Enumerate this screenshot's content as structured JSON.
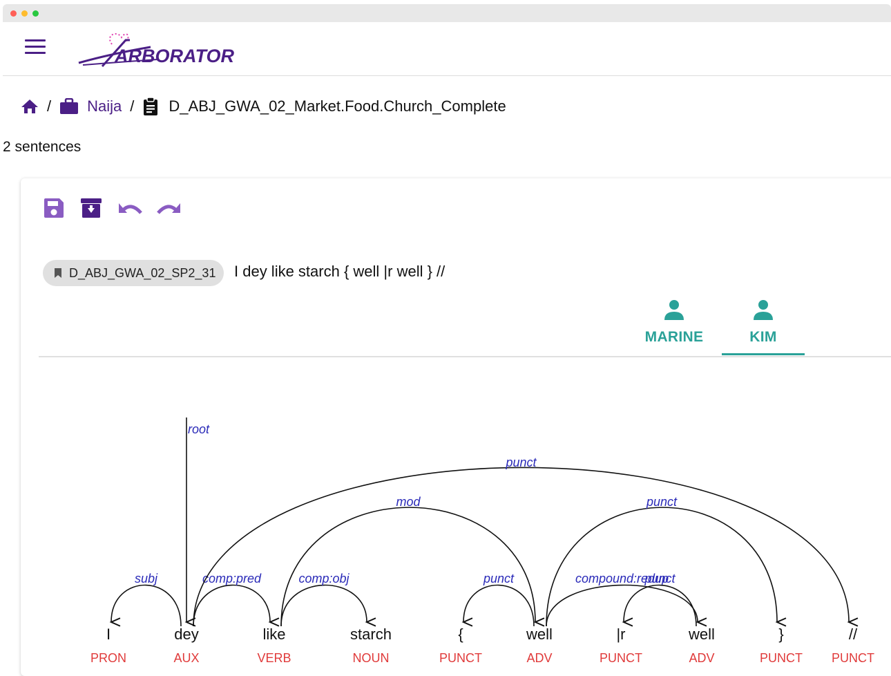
{
  "window": {
    "controls": [
      "close",
      "minimize",
      "maximize"
    ],
    "colors": {
      "close": "#ff5f57",
      "minimize": "#febc2e",
      "maximize": "#28c840"
    }
  },
  "app": {
    "logo_text": "ARBORATOR",
    "menu_icon": "hamburger-menu-icon"
  },
  "breadcrumb": {
    "home_icon": "home-icon",
    "project_icon": "briefcase-icon",
    "project": "Naija",
    "sample_icon": "clipboard-icon",
    "sample": "D_ABJ_GWA_02_Market.Food.Church_Complete",
    "separator": "/"
  },
  "sentence_count": "2 sentences",
  "toolbar": {
    "icons": [
      "save-icon",
      "archive-icon",
      "undo-icon",
      "redo-icon"
    ]
  },
  "sentence": {
    "id_icon": "bookmark-icon",
    "id": "D_ABJ_GWA_02_SP2_31",
    "text": "I dey like starch { well |r well } //"
  },
  "tabs": [
    {
      "label": "MARINE",
      "icon": "person-icon",
      "selected": false
    },
    {
      "label": "KIM",
      "icon": "person-icon",
      "selected": true
    }
  ],
  "colors": {
    "accent": "#4b1f86",
    "tab": "#2aa198",
    "relation": "#2a2ab8",
    "pos": "#e03a3a"
  },
  "tree": {
    "tokens": [
      {
        "form": "I",
        "upos": "PRON"
      },
      {
        "form": "dey",
        "upos": "AUX"
      },
      {
        "form": "like",
        "upos": "VERB"
      },
      {
        "form": "starch",
        "upos": "NOUN"
      },
      {
        "form": "{",
        "upos": "PUNCT"
      },
      {
        "form": "well",
        "upos": "ADV"
      },
      {
        "form": "|r",
        "upos": "PUNCT"
      },
      {
        "form": "well",
        "upos": "ADV"
      },
      {
        "form": "}",
        "upos": "PUNCT"
      },
      {
        "form": "//",
        "upos": "PUNCT"
      }
    ],
    "root": {
      "dep": 1,
      "label": "root"
    },
    "relations": [
      {
        "head": 1,
        "dep": 0,
        "label": "subj"
      },
      {
        "head": 1,
        "dep": 2,
        "label": "comp:pred"
      },
      {
        "head": 2,
        "dep": 3,
        "label": "comp:obj"
      },
      {
        "head": 2,
        "dep": 5,
        "label": "mod"
      },
      {
        "head": 5,
        "dep": 4,
        "label": "punct"
      },
      {
        "head": 5,
        "dep": 7,
        "label": "compound:redup"
      },
      {
        "head": 7,
        "dep": 6,
        "label": "punct"
      },
      {
        "head": 5,
        "dep": 8,
        "label": "punct"
      },
      {
        "head": 1,
        "dep": 9,
        "label": "punct"
      }
    ]
  }
}
